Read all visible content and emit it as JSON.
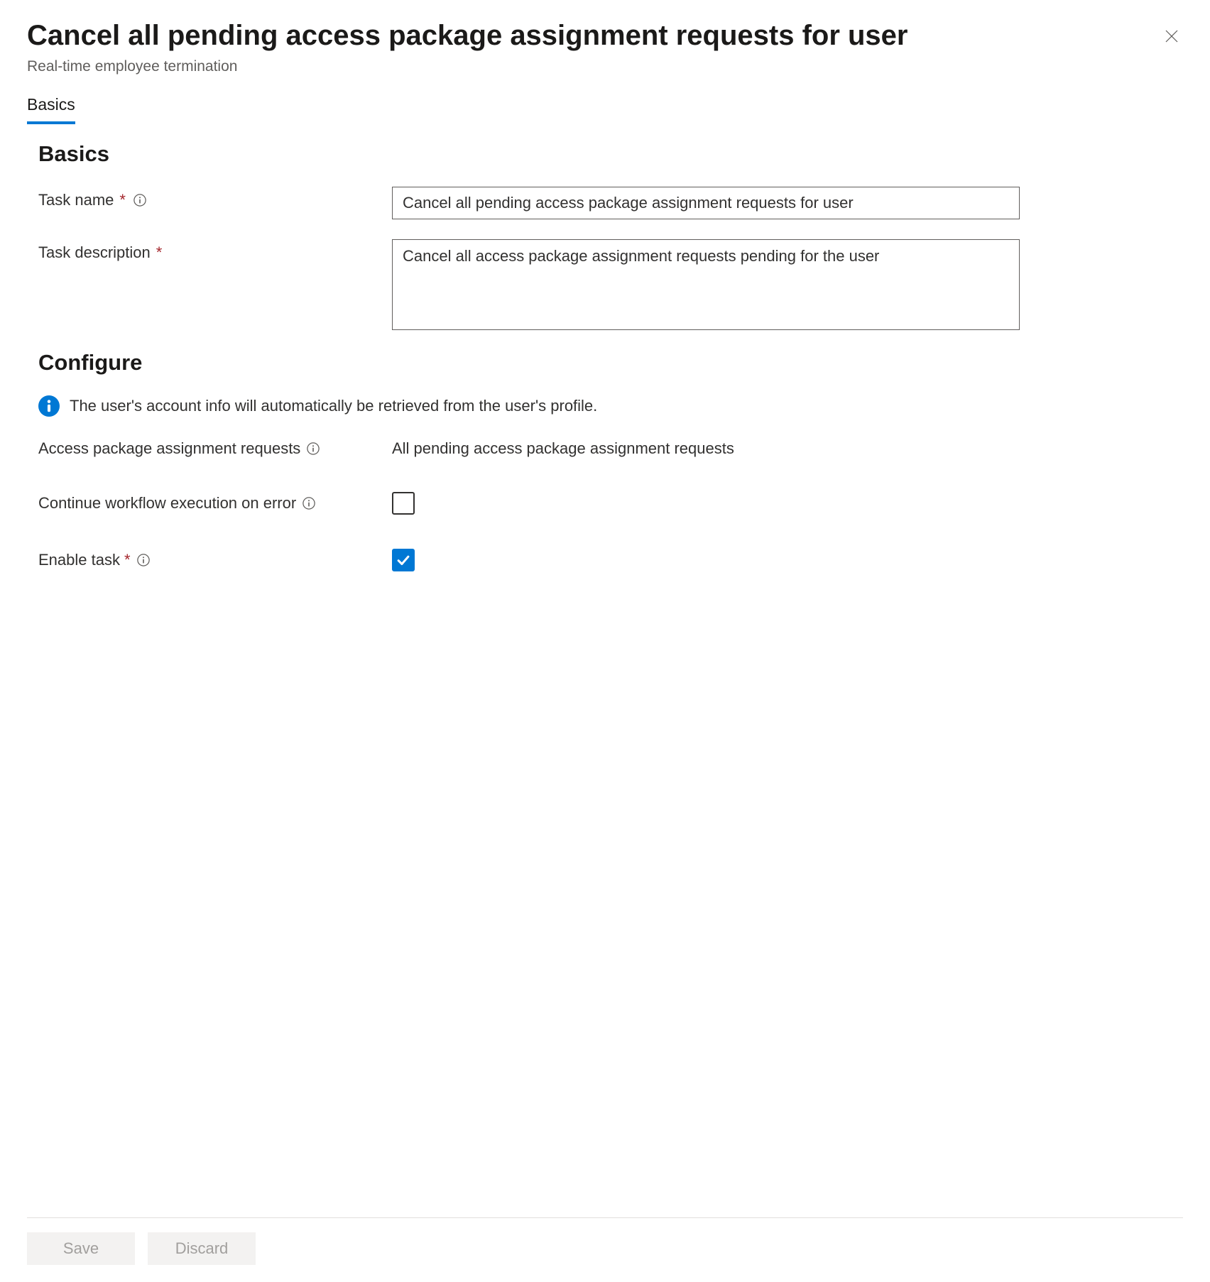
{
  "header": {
    "title": "Cancel all pending access package assignment requests for user",
    "subtitle": "Real-time employee termination"
  },
  "tabs": [
    {
      "label": "Basics",
      "active": true
    }
  ],
  "sections": {
    "basics": {
      "heading": "Basics",
      "fields": {
        "task_name": {
          "label": "Task name",
          "required": true,
          "value": "Cancel all pending access package assignment requests for user"
        },
        "task_description": {
          "label": "Task description",
          "required": true,
          "value": "Cancel all access package assignment requests pending for the user"
        }
      }
    },
    "configure": {
      "heading": "Configure",
      "info_message": "The user's account info will automatically be retrieved from the user's profile.",
      "fields": {
        "access_package_requests": {
          "label": "Access package assignment requests",
          "value": "All pending access package assignment requests"
        },
        "continue_on_error": {
          "label": "Continue workflow execution on error",
          "checked": false
        },
        "enable_task": {
          "label": "Enable task",
          "required": true,
          "checked": true
        }
      }
    }
  },
  "footer": {
    "save_label": "Save",
    "discard_label": "Discard"
  }
}
